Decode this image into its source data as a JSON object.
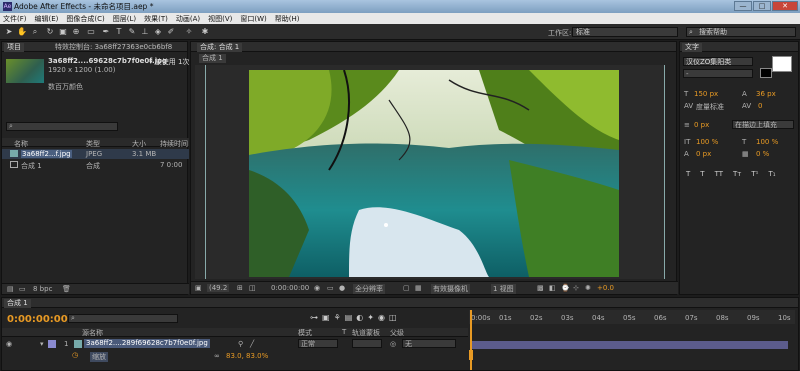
{
  "app": {
    "title": "Adobe After Effects - 未命名项目.aep *",
    "logo_text": "Ae"
  },
  "window_buttons": {
    "minimize": "—",
    "maximize": "□",
    "close": "✕"
  },
  "menu": [
    "文件(F)",
    "编辑(E)",
    "图像合成(C)",
    "图层(L)",
    "效果(T)",
    "动画(A)",
    "视图(V)",
    "窗口(W)",
    "帮助(H)"
  ],
  "toolbar": {
    "workspace_label": "工作区:",
    "workspace_value": "标准",
    "search_help": "搜索帮助"
  },
  "project_panel": {
    "tab1": "项目",
    "tab2": "特效控制台: 3a68ff27363e0cb6bf8",
    "file_name": "3a68ff2....69628c7b7f0e0f.jpg",
    "used_times": "▾ 被使用 1次",
    "dimensions": "1920 x 1200 (1.00)",
    "colors": "数百万颜色",
    "columns": {
      "name": "名称",
      "type": "类型",
      "size": "大小",
      "duration": "持续时间"
    },
    "rows": [
      {
        "name": "3a68ff2...f.jpg",
        "type": "JPEG",
        "size": "3.1 MB",
        "duration": ""
      },
      {
        "name": "合成 1",
        "type": "合成",
        "size": "",
        "duration": "7 0:00"
      }
    ],
    "bpc": "8 bpc"
  },
  "comp_panel": {
    "tab": "合成: 合成 1",
    "subtab": "合成 1",
    "zoom": "(49.2",
    "timecode": "0:00:00:00",
    "resolution": "全分辨率",
    "camera": "有效摄像机",
    "views": "1 视图",
    "exposure": "+0.0"
  },
  "char_panel": {
    "tab": "文字",
    "font": "汉仪ZO集阳类",
    "style": "-",
    "size": "150 px",
    "leading": "36 px",
    "kerning_label": "度量标准",
    "tracking": "0",
    "stroke": "0 px",
    "stroke_mode": "在描边上填充",
    "vscale": "100 %",
    "hscale": "100 %",
    "baseline": "0 px",
    "tsume": "0 %",
    "styles": [
      "T",
      "T",
      "TT",
      "Tт",
      "T¹",
      "T₁"
    ]
  },
  "timeline": {
    "tab": "合成 1",
    "timecode": "0:00:00:00",
    "headers": {
      "source": "源名称",
      "mode": "模式",
      "t": "T",
      "track": "轨道蒙板",
      "parent": "父级"
    },
    "layer": {
      "num": "1",
      "name": "3a68ff2....289f69628c7b7f0e0f.jpg",
      "mode": "正常",
      "parent": "无"
    },
    "sub_prop": {
      "name": "缩放",
      "value": "83.0, 83.0%"
    },
    "ruler": [
      "0:00s",
      "01s",
      "02s",
      "03s",
      "04s",
      "05s",
      "06s",
      "07s",
      "08s",
      "09s",
      "10s"
    ]
  },
  "colors": {
    "accent": "#e89a24",
    "bg": "#232323",
    "titlebar": "#8fb0d0"
  }
}
